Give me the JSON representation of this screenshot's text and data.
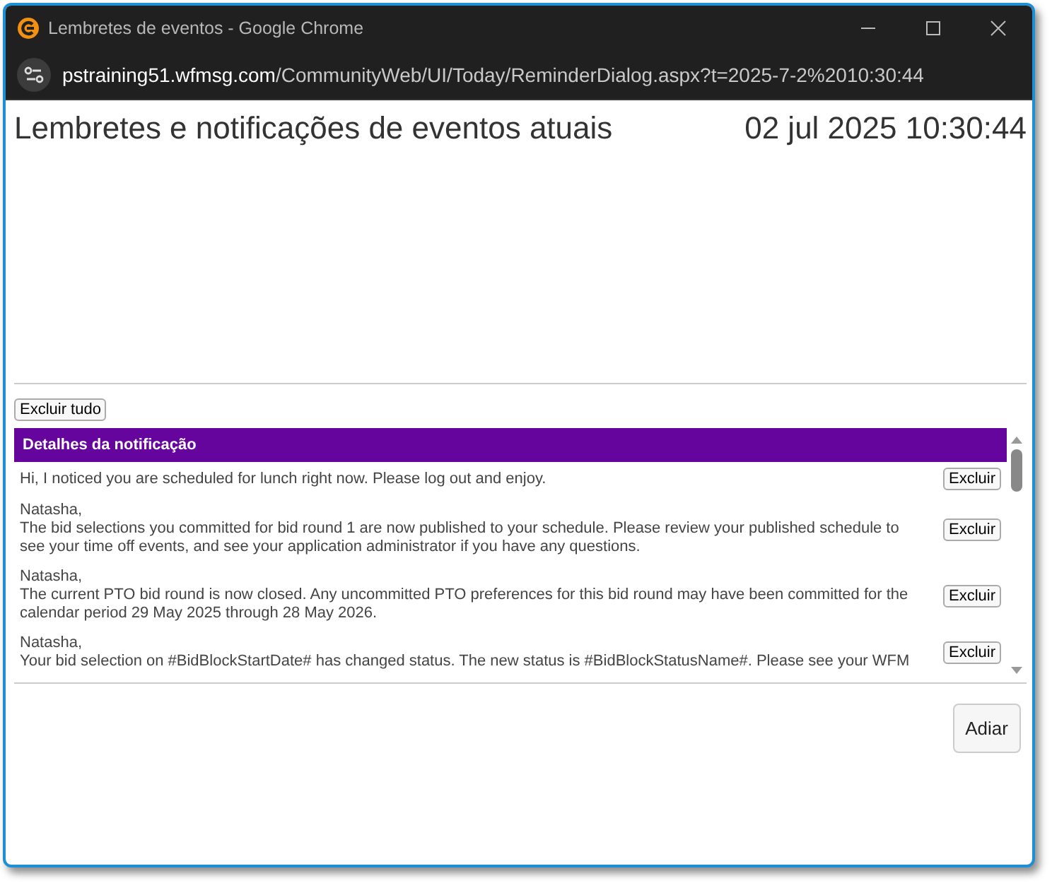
{
  "window": {
    "title": "Lembretes de eventos - Google Chrome"
  },
  "address_bar": {
    "domain": "pstraining51.wfmsg.com",
    "path": "/CommunityWeb/UI/Today/ReminderDialog.aspx?t=2025-7-2%2010:30:44"
  },
  "page": {
    "heading": "Lembretes e notificações de eventos atuais",
    "datetime": "02 jul 2025 10:30:44"
  },
  "delete_all_button": "Excluir tudo",
  "table": {
    "header": "Detalhes da notificação",
    "rows": [
      {
        "greeting": "",
        "message": "Hi, I noticed you are scheduled for lunch right now. Please log out and enjoy.",
        "button": "Excluir"
      },
      {
        "greeting": "Natasha,",
        "message": "The bid selections you committed for bid round 1 are now published to your schedule. Please review your published schedule to\nsee your time off events, and see your application administrator if you have any questions.",
        "button": "Excluir"
      },
      {
        "greeting": "Natasha,",
        "message": "The current PTO bid round is now closed. Any uncommitted PTO preferences for this bid round may have been committed for the\ncalendar period 29 May 2025 through 28 May 2026.",
        "button": "Excluir"
      },
      {
        "greeting": "Natasha,",
        "message": "Your bid selection on #BidBlockStartDate# has changed status. The new status is #BidBlockStatusName#. Please see your WFM",
        "button": "Excluir"
      }
    ]
  },
  "snooze_button": "Adiar"
}
